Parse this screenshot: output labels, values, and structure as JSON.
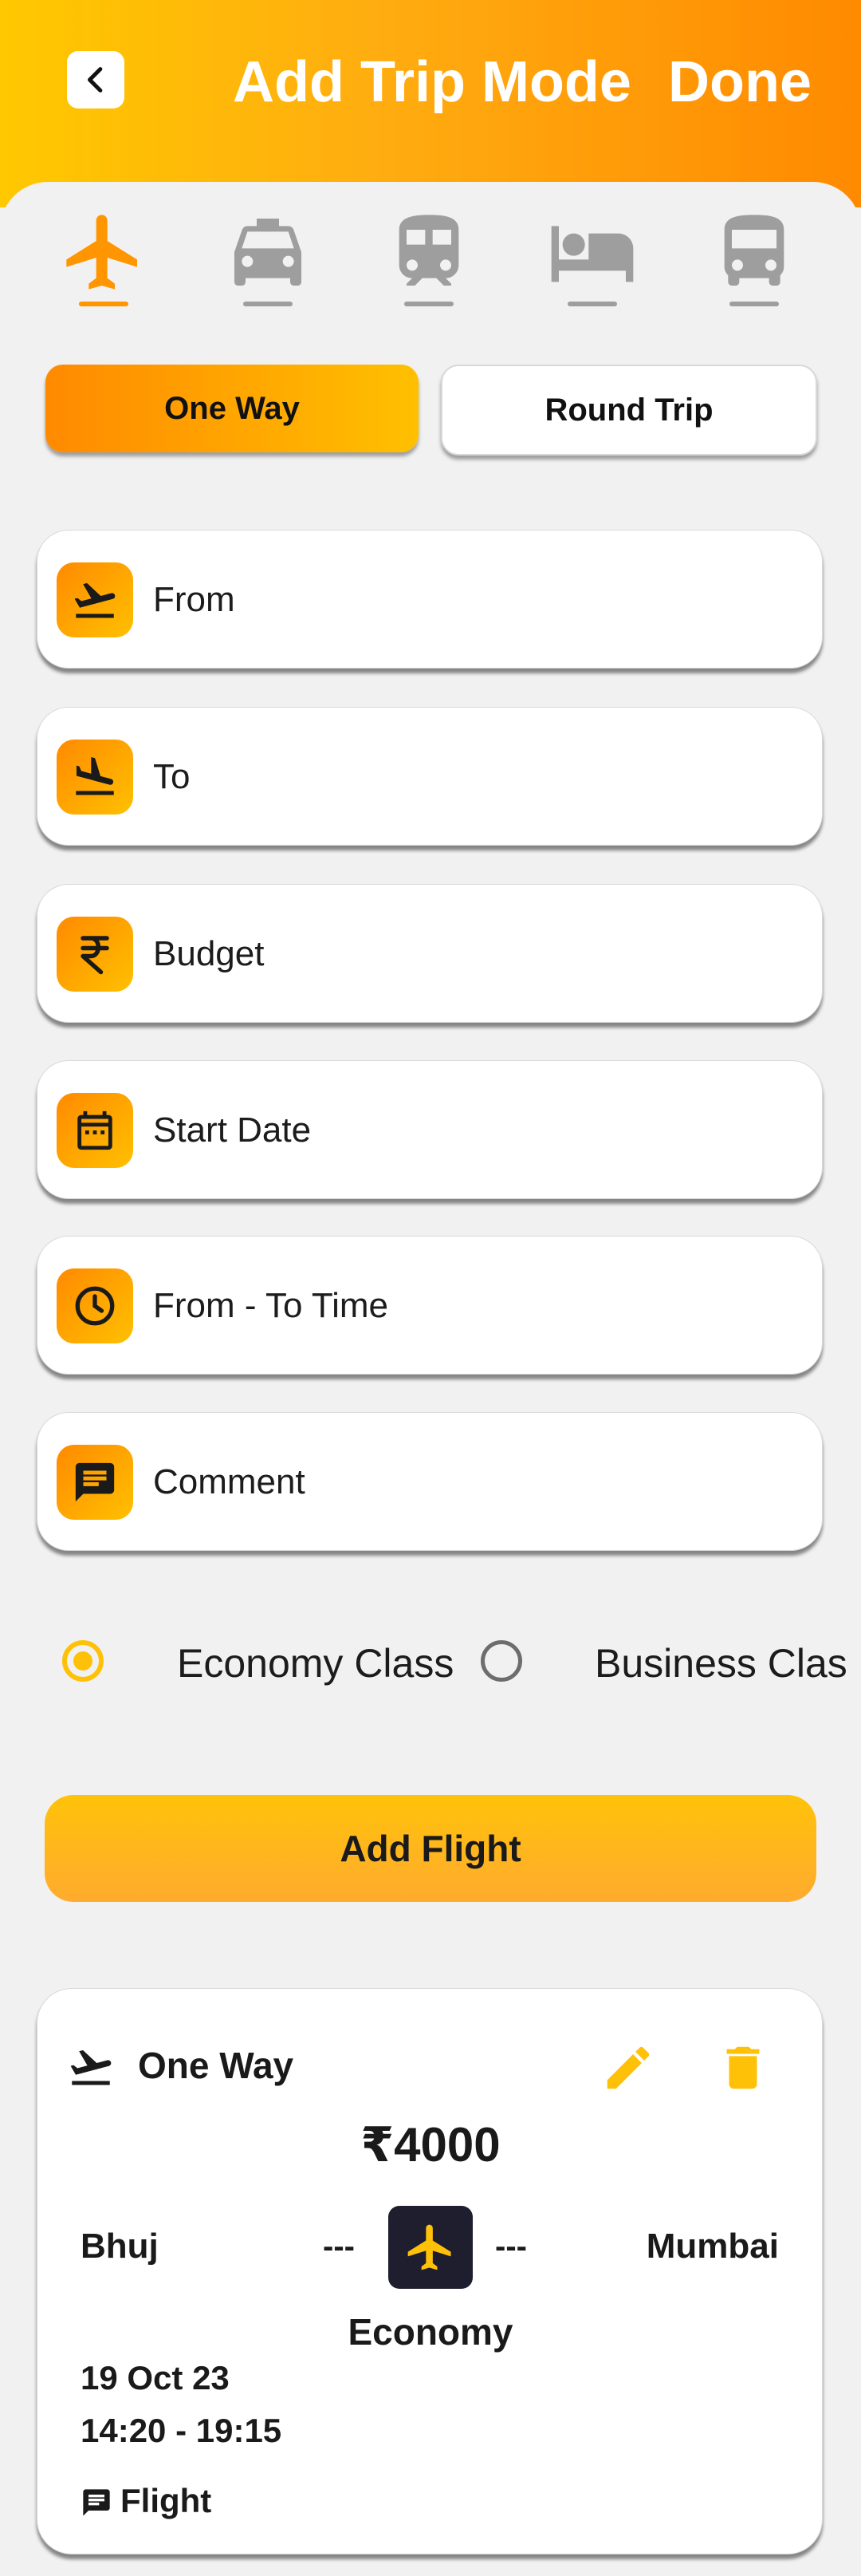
{
  "header": {
    "title": "Add Trip Mode",
    "done_label": "Done",
    "gradient": [
      "#ffc800",
      "#ff8a00"
    ]
  },
  "modes": [
    {
      "name": "flight",
      "icon": "airplane-icon",
      "active": true
    },
    {
      "name": "taxi",
      "icon": "taxi-icon",
      "active": false
    },
    {
      "name": "train",
      "icon": "train-icon",
      "active": false
    },
    {
      "name": "hotel",
      "icon": "bed-icon",
      "active": false
    },
    {
      "name": "bus",
      "icon": "bus-icon",
      "active": false
    }
  ],
  "trip_type": {
    "one_way": "One Way",
    "round_trip": "Round Trip",
    "selected": "One Way"
  },
  "fields": {
    "from": {
      "placeholder": "From",
      "icon": "flight-takeoff-icon"
    },
    "to": {
      "placeholder": "To",
      "icon": "flight-land-icon"
    },
    "budget": {
      "placeholder": "Budget",
      "icon": "rupee-icon"
    },
    "start_date": {
      "placeholder": "Start Date",
      "icon": "calendar-icon"
    },
    "time": {
      "placeholder": "From - To Time",
      "icon": "clock-icon"
    },
    "comment": {
      "placeholder": "Comment",
      "icon": "comment-icon"
    }
  },
  "travel_class": {
    "economy": "Economy Class",
    "business": "Business Clas",
    "selected": "Economy Class"
  },
  "add_flight_label": "Add Flight",
  "flight_card": {
    "type": "One Way",
    "price": "₹4000",
    "from": "Bhuj",
    "to": "Mumbai",
    "dash_left": "---",
    "dash_right": "---",
    "class": "Economy",
    "date": "19 Oct 23",
    "time": "14:20 -  19:15",
    "comment": "Flight"
  },
  "colors": {
    "accent": "#ff9500",
    "accent_light": "#ffc107",
    "icon_gray": "#9e9e9e",
    "background": "#f1f1f2"
  }
}
